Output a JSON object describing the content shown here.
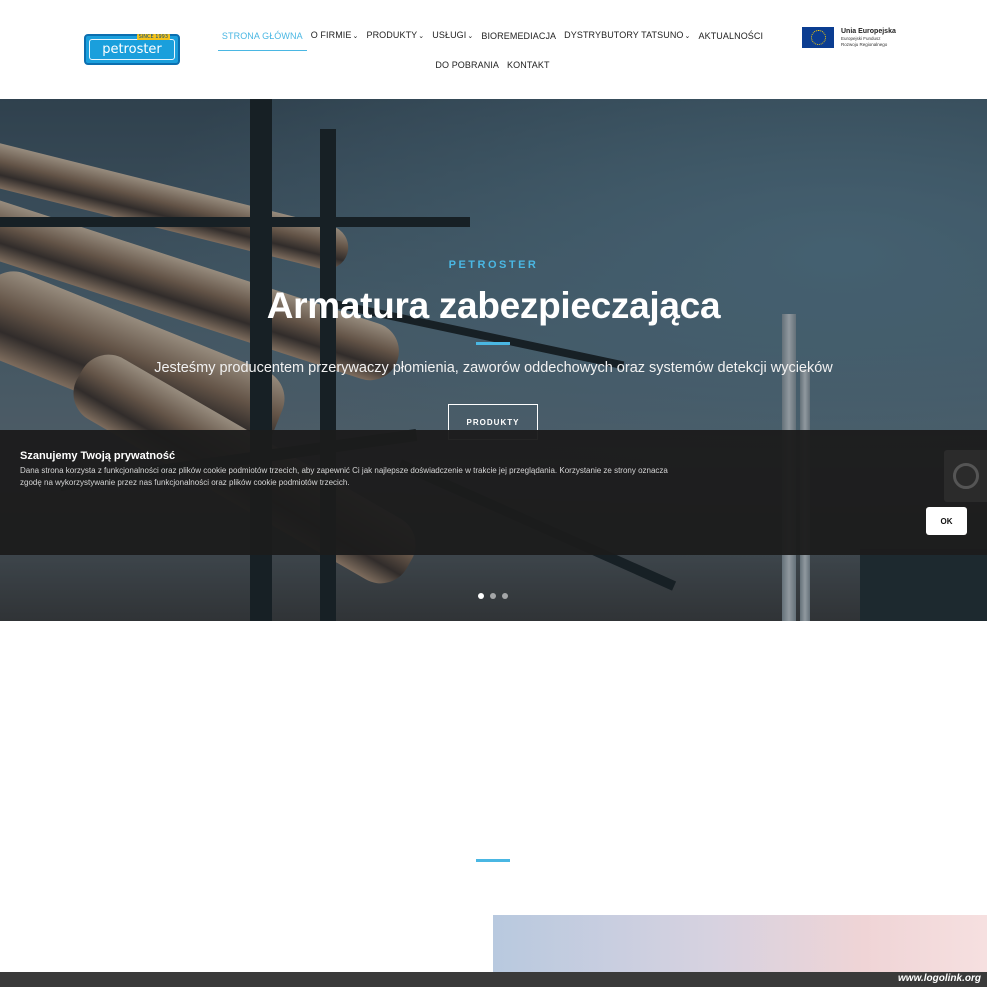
{
  "header": {
    "logo": {
      "text": "petroster",
      "badge": "SINCE 1993"
    },
    "nav": {
      "row1": [
        {
          "label": "STRONA GŁÓWNA",
          "active": true,
          "dropdown": false
        },
        {
          "label": "O FIRMIE",
          "active": false,
          "dropdown": true
        },
        {
          "label": "PRODUKTY",
          "active": false,
          "dropdown": true
        },
        {
          "label": "USŁUGI",
          "active": false,
          "dropdown": true
        },
        {
          "label": "BIOREMEDIACJA",
          "active": false,
          "dropdown": false
        },
        {
          "label": "DYSTRYBUTORY TATSUNO",
          "active": false,
          "dropdown": true
        },
        {
          "label": "AKTUALNOŚCI",
          "active": false,
          "dropdown": false
        }
      ],
      "row2": [
        {
          "label": "DO POBRANIA",
          "active": false,
          "dropdown": false
        },
        {
          "label": "KONTAKT",
          "active": false,
          "dropdown": false
        }
      ],
      "caret": "⌄"
    },
    "eu": {
      "title": "Unia Europejska",
      "line1": "Europejski Fundusz",
      "line2": "Rozwoju Regionalnego"
    }
  },
  "hero": {
    "kicker": "PETROSTER",
    "title": "Armatura zabezpieczająca",
    "subtitle": "Jesteśmy producentem przerywaczy płomienia, zaworów oddechowych oraz systemów detekcji wycieków",
    "button_label": "PRODUKTY",
    "slides": 3,
    "active_slide": 0
  },
  "cookie": {
    "title": "Szanujemy Twoją prywatność",
    "text": "Dana strona korzysta z funkcjonalności oraz plików cookie podmiotów trzecich, aby zapewnić Ci jak najlepsze doświadczenie w trakcie jej przeglądania. Korzystanie ze strony oznacza zgodę na wykorzystywanie przez nas funkcjonalności oraz plików cookie podmiotów trzecich.",
    "ok_label": "OK"
  },
  "footer": {
    "watermark": "www.logolink.org"
  },
  "colors": {
    "accent": "#4ab7e3",
    "logo_blue": "#1a9fdc",
    "cookie_bg": "#1c1c1c"
  }
}
